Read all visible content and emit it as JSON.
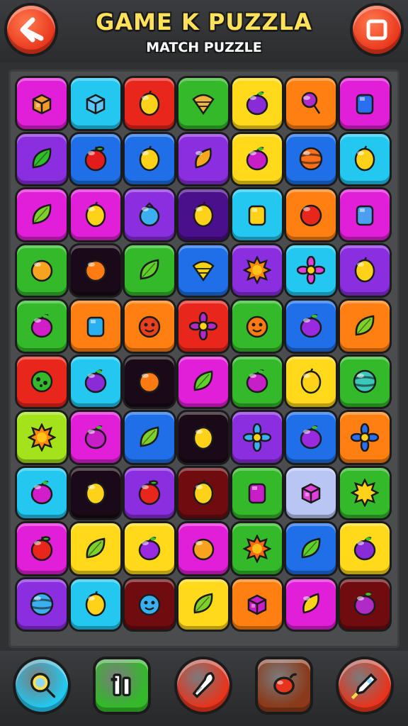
{
  "header": {
    "title": "GAME K PUZZLA",
    "subtitle": "MATCH PUZZLE",
    "back_icon": "back-arrow-icon",
    "stop_icon": "stop-icon"
  },
  "colors": {
    "magenta": "#e21fd8",
    "cyan": "#22c8f0",
    "red": "#e8261c",
    "green": "#33b92a",
    "yellow": "#ffd91a",
    "orange": "#ff7f10",
    "purple": "#8a2fe0",
    "blue": "#1e6fe8",
    "black": "#1a0a18",
    "maroon": "#6e0c10",
    "dark-purple": "#4a0f8a",
    "lime": "#a4e21c",
    "lavender": "#b9c6f4"
  },
  "board": {
    "columns": 7,
    "rows": 10,
    "tiles": [
      [
        [
          "magenta",
          "box",
          "#f09a2a"
        ],
        [
          "cyan",
          "cube",
          "#5cc8f8"
        ],
        [
          "red",
          "lemon",
          "#ffd21a"
        ],
        [
          "green",
          "shell",
          "#f2b43a"
        ],
        [
          "yellow",
          "plum",
          "#8a2bd8"
        ],
        [
          "orange",
          "lollipop",
          "#b02ac8"
        ],
        [
          "magenta",
          "gem",
          "#2a6ff0"
        ]
      ],
      [
        [
          "purple",
          "leaf",
          "#2fbf2a"
        ],
        [
          "blue",
          "apple",
          "#e21c1c"
        ],
        [
          "blue",
          "lemon",
          "#ffd21a"
        ],
        [
          "purple",
          "mango",
          "#f5a820"
        ],
        [
          "yellow",
          "plum",
          "#c81ec8"
        ],
        [
          "blue",
          "striped-ball",
          "#ff6f1a"
        ],
        [
          "cyan",
          "lemon",
          "#ffd21a"
        ]
      ],
      [
        [
          "magenta",
          "leaf",
          "#7ed12a"
        ],
        [
          "magenta",
          "lemon",
          "#ffd21a"
        ],
        [
          "purple",
          "berry",
          "#3ab0f0"
        ],
        [
          "dark-purple",
          "lemon",
          "#ffd21a"
        ],
        [
          "cyan",
          "gem",
          "#ffd21a"
        ],
        [
          "orange",
          "orange",
          "#e8261c"
        ],
        [
          "magenta",
          "gem",
          "#4a9ff0"
        ]
      ],
      [
        [
          "green",
          "orange",
          "#f7a320"
        ],
        [
          "black",
          "orange",
          "#ff7a10"
        ],
        [
          "green",
          "leaf",
          "#5fd12a"
        ],
        [
          "blue",
          "shell",
          "#f2d21a"
        ],
        [
          "purple",
          "sun",
          "#ff8a10"
        ],
        [
          "cyan",
          "flower",
          "#e040d8"
        ],
        [
          "purple",
          "lemon",
          "#ffd21a"
        ]
      ],
      [
        [
          "green",
          "plum",
          "#d21ec8"
        ],
        [
          "orange",
          "gem",
          "#2ab0f0"
        ],
        [
          "orange",
          "face",
          "#e8401c"
        ],
        [
          "red",
          "flower",
          "#b02ac8"
        ],
        [
          "green",
          "face",
          "#ff7a10"
        ],
        [
          "blue",
          "plum",
          "#9a2ae0"
        ],
        [
          "orange",
          "leaf",
          "#7ed12a"
        ]
      ],
      [
        [
          "red",
          "virus",
          "#33b92a"
        ],
        [
          "cyan",
          "plum",
          "#8a2bd8"
        ],
        [
          "black",
          "orange",
          "#ff7a10"
        ],
        [
          "magenta",
          "leaf",
          "#5fd12a"
        ],
        [
          "green",
          "plum",
          "#c81ec8"
        ],
        [
          "yellow",
          "lemon",
          "#ffd21a"
        ],
        [
          "green",
          "striped-ball",
          "#3ac8b8"
        ]
      ],
      [
        [
          "lime",
          "sun",
          "#ff8a10"
        ],
        [
          "magenta",
          "plum",
          "#c81ec8"
        ],
        [
          "blue",
          "leaf",
          "#7ed12a"
        ],
        [
          "black",
          "lemon",
          "#ffd21a"
        ],
        [
          "purple",
          "flower",
          "#3ab0f0"
        ],
        [
          "blue",
          "plum",
          "#9a2ae0"
        ],
        [
          "orange",
          "flower",
          "#2a6ff0"
        ]
      ],
      [
        [
          "cyan",
          "plum",
          "#d21ec8"
        ],
        [
          "black",
          "lemon",
          "#ffd21a"
        ],
        [
          "purple",
          "apple",
          "#e8261c"
        ],
        [
          "maroon",
          "lemon",
          "#ffd21a"
        ],
        [
          "green",
          "gem",
          "#c81ec8"
        ],
        [
          "lavender",
          "box",
          "#e040d8"
        ],
        [
          "green",
          "sun",
          "#ffd21a"
        ]
      ],
      [
        [
          "magenta",
          "apple",
          "#e8261c"
        ],
        [
          "yellow",
          "leaf",
          "#7ed12a"
        ],
        [
          "yellow",
          "plum",
          "#9a2ae0"
        ],
        [
          "magenta",
          "orange",
          "#f7a320"
        ],
        [
          "green",
          "sun",
          "#ff6a10"
        ],
        [
          "blue",
          "leaf",
          "#5fd12a"
        ],
        [
          "yellow",
          "plum",
          "#8a2bd8"
        ]
      ],
      [
        [
          "purple",
          "striped-ball",
          "#3ab0f0"
        ],
        [
          "cyan",
          "lemon",
          "#ffd21a"
        ],
        [
          "maroon",
          "face",
          "#3ab0f0"
        ],
        [
          "yellow",
          "leaf",
          "#7ed12a"
        ],
        [
          "orange",
          "box",
          "#c81ec8"
        ],
        [
          "magenta",
          "mango",
          "#ffd21a"
        ],
        [
          "maroon",
          "plum",
          "#b02ac8"
        ]
      ]
    ]
  },
  "toolbar": [
    {
      "name": "magnifier-button",
      "icon": "magnifier-icon",
      "bg": "#22c8f0",
      "shape": "circle"
    },
    {
      "name": "shuffle-button",
      "icon": "shuffle-icon",
      "bg": "#33b92a",
      "shape": "square"
    },
    {
      "name": "drill-button",
      "icon": "drill-icon",
      "bg": "#e8341c",
      "shape": "circle"
    },
    {
      "name": "bomb-button",
      "icon": "seed-icon",
      "bg": "#8a3a1a",
      "shape": "square"
    },
    {
      "name": "rocket-button",
      "icon": "rocket-icon",
      "bg": "#e8341c",
      "shape": "circle"
    }
  ]
}
